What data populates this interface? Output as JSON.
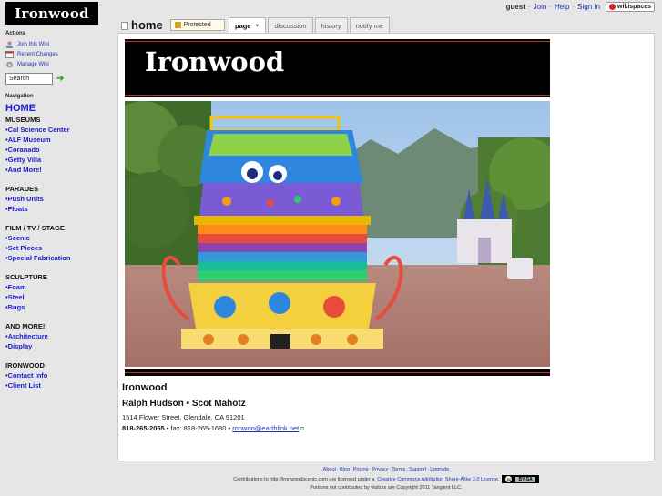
{
  "logo": {
    "text": "Ironwood"
  },
  "userbar": {
    "user": "guest",
    "links": [
      "Join",
      "Help",
      "Sign In"
    ],
    "badge": "wikispaces"
  },
  "header": {
    "page_title": "home",
    "protected_label": "Protected",
    "tabs": [
      "page",
      "discussion",
      "history",
      "notify me"
    ]
  },
  "sidebar": {
    "actions_title": "Actions",
    "actions": [
      "Join this Wiki",
      "Recent Changes",
      "Manage Wiki"
    ],
    "search_placeholder": "Search",
    "navigation_title": "Navigation",
    "home": "HOME",
    "groups": [
      {
        "title": "MUSEUMS",
        "items": [
          "Cal Science Center",
          "ALF Museum",
          "Coranado",
          "Getty Villa",
          "And More!"
        ]
      },
      {
        "title": "PARADES",
        "items": [
          "Push Units",
          "Floats"
        ]
      },
      {
        "title": "FILM / TV / STAGE",
        "items": [
          "Scenic",
          "Set Pieces",
          "Special Fabrication"
        ]
      },
      {
        "title": "SCULPTURE",
        "items": [
          "Foam",
          "Steel",
          "Bugs"
        ]
      },
      {
        "title": "AND MORE!",
        "items": [
          "Architecture",
          "Display"
        ]
      },
      {
        "title": "IRONWOOD",
        "items": [
          "Contact Info",
          "Client List"
        ]
      }
    ]
  },
  "main": {
    "banner_text": "Ironwood",
    "company": "Ironwood",
    "people": "Ralph Hudson • Scot Mahotz",
    "address": "1514 Flower Street, Glendale, CA 91201",
    "phone": "818-265-2055",
    "fax": " • fax: 818-265-1680 • ",
    "email": "ronwoo@earthlink.net"
  },
  "footer": {
    "links": [
      "About",
      "Blog",
      "Pricing",
      "Privacy",
      "Terms",
      "Support",
      "Upgrade"
    ],
    "contrib_prefix": "Contributions to http://ironwoodscenic.com are licensed under a",
    "license_link": "Creative Commons Attribution Share-Alike 3.0 License.",
    "cc_badge": "BY-SA",
    "copyright": "Portions not contributed by visitors are Copyright 2011 Tangient LLC."
  },
  "colors": {
    "link": "#2233bb",
    "nav": "#1a1ad0",
    "banner": "#000000",
    "accent_stripe": "#bb3322"
  }
}
